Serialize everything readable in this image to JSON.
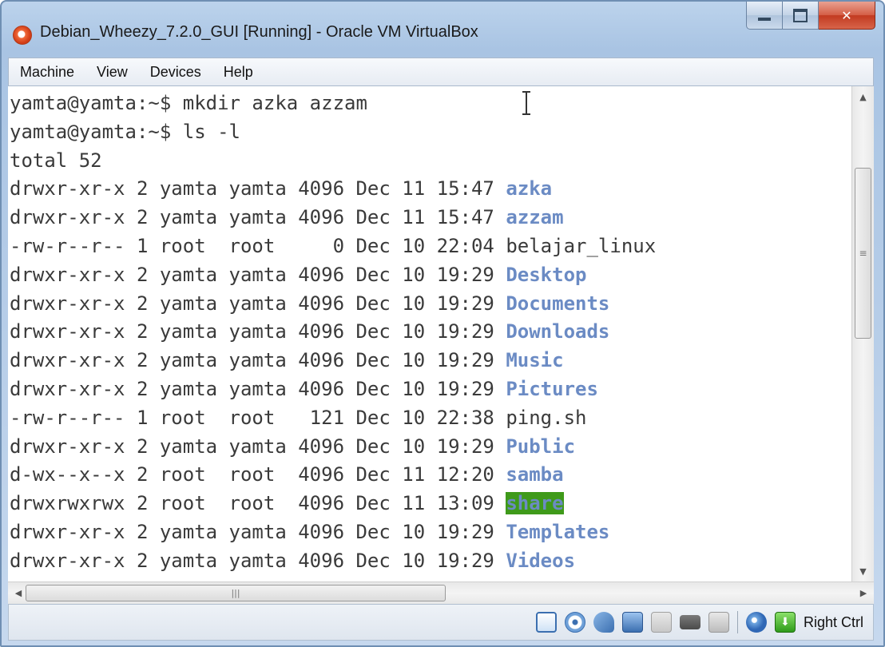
{
  "window": {
    "title": "Debian_Wheezy_7.2.0_GUI [Running] - Oracle VM VirtualBox"
  },
  "menubar": {
    "items": [
      "Machine",
      "View",
      "Devices",
      "Help"
    ]
  },
  "terminal": {
    "lines": [
      {
        "text": "yamta@yamta:~$ mkdir azka azzam",
        "name": "",
        "kind": "plain"
      },
      {
        "text": "yamta@yamta:~$ ls -l",
        "name": "",
        "kind": "plain"
      },
      {
        "text": "total 52",
        "name": "",
        "kind": "plain"
      },
      {
        "text": "drwxr-xr-x 2 yamta yamta 4096 Dec 11 15:47 ",
        "name": "azka",
        "kind": "dir"
      },
      {
        "text": "drwxr-xr-x 2 yamta yamta 4096 Dec 11 15:47 ",
        "name": "azzam",
        "kind": "dir"
      },
      {
        "text": "-rw-r--r-- 1 root  root     0 Dec 10 22:04 ",
        "name": "belajar_linux",
        "kind": "file"
      },
      {
        "text": "drwxr-xr-x 2 yamta yamta 4096 Dec 10 19:29 ",
        "name": "Desktop",
        "kind": "dir"
      },
      {
        "text": "drwxr-xr-x 2 yamta yamta 4096 Dec 10 19:29 ",
        "name": "Documents",
        "kind": "dir"
      },
      {
        "text": "drwxr-xr-x 2 yamta yamta 4096 Dec 10 19:29 ",
        "name": "Downloads",
        "kind": "dir"
      },
      {
        "text": "drwxr-xr-x 2 yamta yamta 4096 Dec 10 19:29 ",
        "name": "Music",
        "kind": "dir"
      },
      {
        "text": "drwxr-xr-x 2 yamta yamta 4096 Dec 10 19:29 ",
        "name": "Pictures",
        "kind": "dir"
      },
      {
        "text": "-rw-r--r-- 1 root  root   121 Dec 10 22:38 ",
        "name": "ping.sh",
        "kind": "file"
      },
      {
        "text": "drwxr-xr-x 2 yamta yamta 4096 Dec 10 19:29 ",
        "name": "Public",
        "kind": "dir"
      },
      {
        "text": "d-wx--x--x 2 root  root  4096 Dec 11 12:20 ",
        "name": "samba",
        "kind": "dir"
      },
      {
        "text": "drwxrwxrwx 2 root  root  4096 Dec 11 13:09 ",
        "name": "share",
        "kind": "other"
      },
      {
        "text": "drwxr-xr-x 2 yamta yamta 4096 Dec 10 19:29 ",
        "name": "Templates",
        "kind": "dir"
      },
      {
        "text": "drwxr-xr-x 2 yamta yamta 4096 Dec 10 19:29 ",
        "name": "Videos",
        "kind": "dir"
      }
    ]
  },
  "statusbar": {
    "host_key": "Right Ctrl",
    "icons": [
      "hard-disk-icon",
      "optical-drive-icon",
      "usb-icon",
      "network-icon",
      "shared-folders-icon",
      "video-capture-icon",
      "display-icon",
      "mouse-integration-icon",
      "keyboard-capture-icon"
    ]
  },
  "colors": {
    "directory": "#6b8bc4",
    "other_writable_bg": "#3f9a1a",
    "text": "#3a3a3a"
  }
}
